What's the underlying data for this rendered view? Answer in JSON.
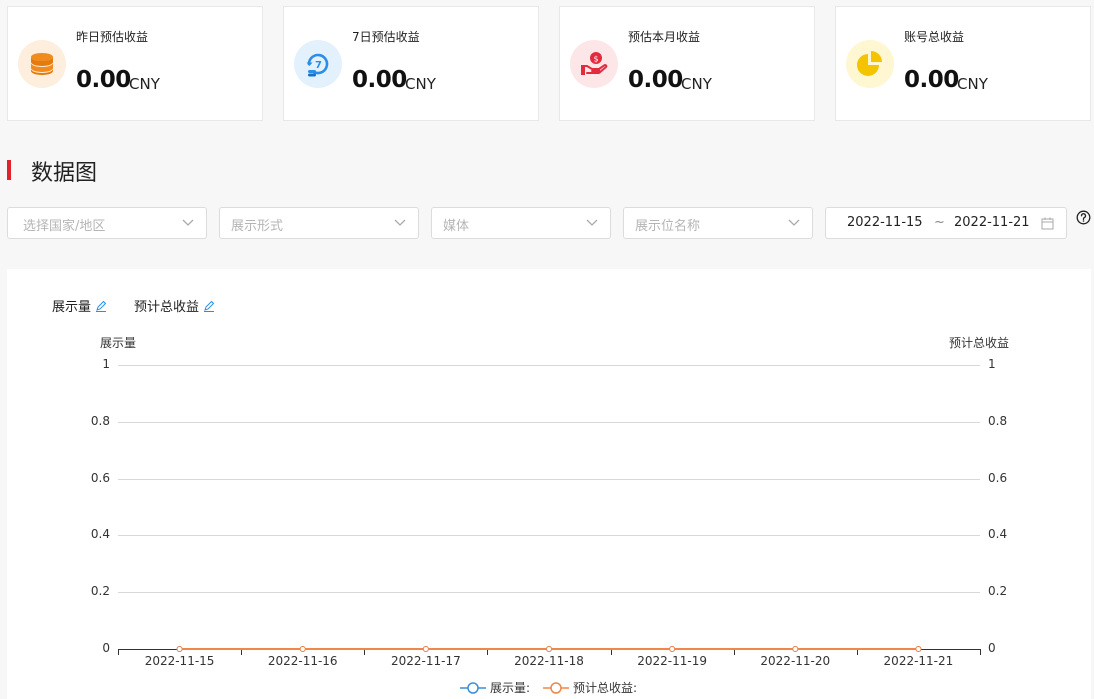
{
  "stats": [
    {
      "label": "昨日预估收益",
      "value": "0.00",
      "unit": "CNY",
      "icon": "coins-stack-icon",
      "color": "#f08c1e",
      "bg": "#fdeedd"
    },
    {
      "label": "7日预估收益",
      "value": "0.00",
      "unit": "CNY",
      "icon": "seven-day-refresh-icon",
      "color": "#2a8ee6",
      "bg": "#e3f1fd"
    },
    {
      "label": "预估本月收益",
      "value": "0.00",
      "unit": "CNY",
      "icon": "money-hand-icon",
      "color": "#e32b3d",
      "bg": "#fde6e8"
    },
    {
      "label": "账号总收益",
      "value": "0.00",
      "unit": "CNY",
      "icon": "pie-chart-icon",
      "color": "#f5c400",
      "bg": "#fff6d2"
    }
  ],
  "section_title": "数据图",
  "filters": {
    "country": "选择国家/地区",
    "display_form": "展示形式",
    "media": "媒体",
    "placement": "展示位名称",
    "date_start": "2022-11-15",
    "date_sep": "~",
    "date_end": "2022-11-21"
  },
  "metrics": [
    "展示量",
    "预计总收益"
  ],
  "chart_data": {
    "type": "line",
    "categories": [
      "2022-11-15",
      "2022-11-16",
      "2022-11-17",
      "2022-11-18",
      "2022-11-19",
      "2022-11-20",
      "2022-11-21"
    ],
    "ylabel_left": "展示量",
    "ylabel_right": "预计总收益",
    "y_ticks": [
      "0",
      "0.2",
      "0.4",
      "0.6",
      "0.8",
      "1"
    ],
    "ylim": [
      0,
      1
    ],
    "grid": true,
    "legend_position": "bottom-center",
    "series": [
      {
        "name": "展示量:",
        "axis": "left",
        "color": "#3c8fd8",
        "values": [
          0,
          0,
          0,
          0,
          0,
          0,
          0
        ]
      },
      {
        "name": "预计总收益:",
        "axis": "right",
        "color": "#f0864a",
        "values": [
          0,
          0,
          0,
          0,
          0,
          0,
          0
        ]
      }
    ]
  }
}
